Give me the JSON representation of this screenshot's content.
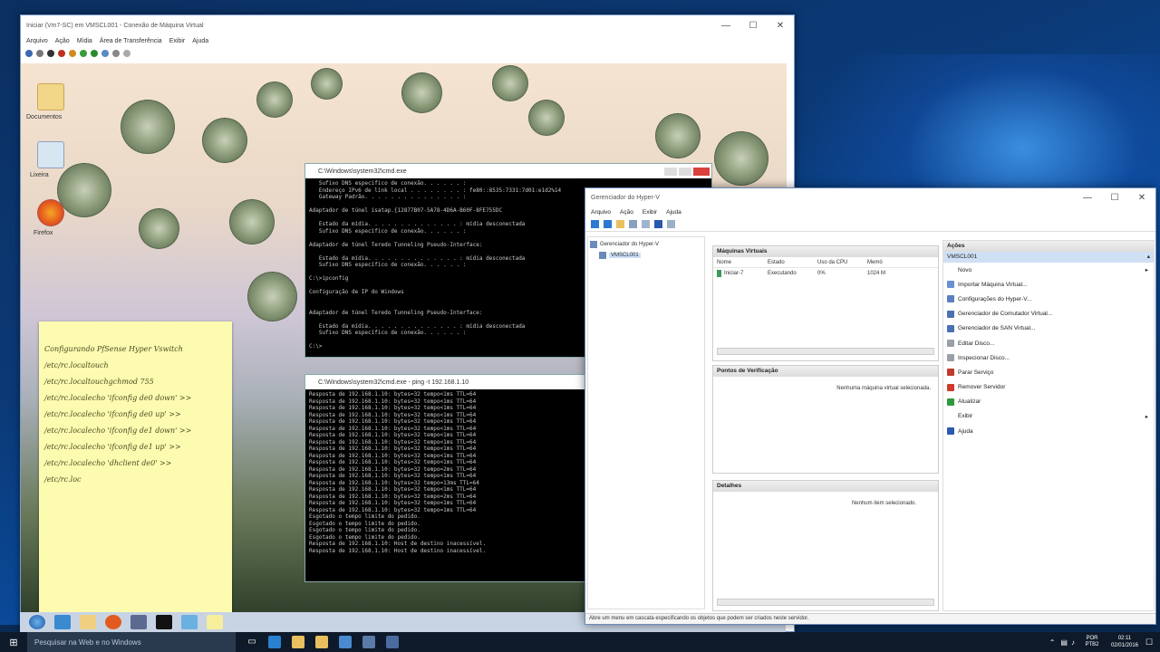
{
  "vm_window": {
    "title": "Iniciar (Vm7-SC) em VMSCL001 - Conexão de Máquina Virtual",
    "menu": [
      "Arquivo",
      "Ação",
      "Mídia",
      "Área de Transferência",
      "Exibir",
      "Ajuda"
    ],
    "controls": {
      "minimize": "—",
      "maximize": "☐",
      "close": "✕"
    }
  },
  "guest_desktop": {
    "icons": [
      {
        "label": "Documentos"
      },
      {
        "label": "Lixeira"
      },
      {
        "label": "Firefox"
      }
    ]
  },
  "sticky_note": {
    "lines": [
      "Configurando PfSense Hyper Vswitch",
      "/etc/rc.localtouch",
      "/etc/rc.localtouchgchmod 755",
      "/etc/rc.localecho 'ifconfig de0 down' >>",
      "/etc/rc.localecho 'ifconfig de0 up' >>",
      "/etc/rc.localecho 'ifconfig de1 down' >>",
      "/etc/rc.localecho 'ifconfig de1 up' >>",
      "/etc/rc.localecho 'dhclient de0' >>",
      "/etc/rc.loc"
    ]
  },
  "cmd1": {
    "title": "C:\\Windows\\system32\\cmd.exe",
    "body": "   Sufixo DNS especifico de conexão. . . . . . :\n   Endereço IPv6 de link local . . . . . . . . : fe80::8535:7331:7d01:e1d2%14\n   Gateway Padrão. . . . . . . . . . . . . . . :\n\nAdaptador de túnel isatap.{12877B07-5A78-4D6A-B60F-8FE755DC\n\n   Estado da mídia. . . . . . . . . . . . . . : mídia desconectada\n   Sufixo DNS específico de conexão. . . . . . :\n\nAdaptador de túnel Teredo Tunneling Pseudo-Interface:\n\n   Estado da mídia. . . . . . . . . . . . . . : mídia desconectada\n   Sufixo DNS específico de conexão. . . . . . :\n\nC:\\>ipconfig\n\nConfiguração de IP do Windows\n\n\nAdaptador de túnel Teredo Tunneling Pseudo-Interface:\n\n   Estado da mídia. . . . . . . . . . . . . . : mídia desconectada\n   Sufixo DNS específico de conexão. . . . . . :\n\nC:\\>"
  },
  "cmd2": {
    "title": "C:\\Windows\\system32\\cmd.exe - ping -t 192.168.1.10",
    "body": "Resposta de 192.168.1.10: bytes=32 tempo<1ms TTL=64\nResposta de 192.168.1.10: bytes=32 tempo<1ms TTL=64\nResposta de 192.168.1.10: bytes=32 tempo<1ms TTL=64\nResposta de 192.168.1.10: bytes=32 tempo<1ms TTL=64\nResposta de 192.168.1.10: bytes=32 tempo<1ms TTL=64\nResposta de 192.168.1.10: bytes=32 tempo<1ms TTL=64\nResposta de 192.168.1.10: bytes=32 tempo<1ms TTL=64\nResposta de 192.168.1.10: bytes=32 tempo<1ms TTL=64\nResposta de 192.168.1.10: bytes=32 tempo<1ms TTL=64\nResposta de 192.168.1.10: bytes=32 tempo<1ms TTL=64\nResposta de 192.168.1.10: bytes=32 tempo<1ms TTL=64\nResposta de 192.168.1.10: bytes=32 tempo=2ms TTL=64\nResposta de 192.168.1.10: bytes=32 tempo<1ms TTL=64\nResposta de 192.168.1.10: bytes=32 tempo=13ms TTL=64\nResposta de 192.168.1.10: bytes=32 tempo<1ms TTL=64\nResposta de 192.168.1.10: bytes=32 tempo=2ms TTL=64\nResposta de 192.168.1.10: bytes=32 tempo<1ms TTL=64\nResposta de 192.168.1.10: bytes=32 tempo=1ms TTL=64\nEsgotado o tempo limite do pedido.\nEsgotado o tempo limite do pedido.\nEsgotado o tempo limite do pedido.\nEsgotado o tempo limite do pedido.\nResposta de 192.168.1.10: Host de destino inacessível.\nResposta de 192.168.1.10: Host de destino inacessível."
  },
  "hyperv": {
    "title": "Gerenciador do Hyper-V",
    "menu": [
      "Arquivo",
      "Ação",
      "Exibir",
      "Ajuda"
    ],
    "tree_root": "Gerenciador do Hyper-V",
    "tree_server": "VMSCL001",
    "vm_pane": {
      "header": "Máquinas Virtuais",
      "columns": [
        "Nome",
        "Estado",
        "Uso da CPU",
        "Memó"
      ],
      "rows": [
        {
          "name": "Iniciar-7",
          "state": "Executando",
          "cpu": "0%",
          "mem": "1024 M"
        }
      ]
    },
    "checkpoints": {
      "header": "Pontos de Verificação",
      "empty": "Nenhuma máquina virtual selecionada."
    },
    "details": {
      "header": "Detalhes",
      "empty": "Nenhum item selecionado."
    },
    "actions": {
      "header": "Ações",
      "section": "VMSCL001",
      "items": [
        {
          "label": "Novo",
          "icon": "new-icon",
          "color": "#ffffff",
          "arrow": "▸"
        },
        {
          "label": "Importar Máquina Virtual...",
          "icon": "import-icon",
          "color": "#6b8fd0",
          "arrow": ""
        },
        {
          "label": "Configurações do Hyper-V...",
          "icon": "settings-icon",
          "color": "#5a80c0",
          "arrow": ""
        },
        {
          "label": "Gerenciador de Comutador Virtual...",
          "icon": "switch-icon",
          "color": "#4a70b0",
          "arrow": ""
        },
        {
          "label": "Gerenciador de SAN Virtual...",
          "icon": "san-icon",
          "color": "#4a70b0",
          "arrow": ""
        },
        {
          "label": "Editar Disco...",
          "icon": "edit-disk-icon",
          "color": "#9aa0a8",
          "arrow": ""
        },
        {
          "label": "Inspecionar Disco...",
          "icon": "inspect-disk-icon",
          "color": "#9aa0a8",
          "arrow": ""
        },
        {
          "label": "Parar Serviço",
          "icon": "stop-icon",
          "color": "#c0392b",
          "arrow": ""
        },
        {
          "label": "Remover Servidor",
          "icon": "remove-icon",
          "color": "#d03a2a",
          "arrow": ""
        },
        {
          "label": "Atualizar",
          "icon": "refresh-icon",
          "color": "#2e9a3e",
          "arrow": ""
        },
        {
          "label": "Exibir",
          "icon": "view-icon",
          "color": "#ffffff",
          "arrow": "▸"
        },
        {
          "label": "Ajuda",
          "icon": "help-icon",
          "color": "#2a5ab0",
          "arrow": ""
        }
      ]
    },
    "status": "Abre um menu em cascata especificando os objetos que podem ser criados neste servidor."
  },
  "host_taskbar": {
    "search_placeholder": "Pesquisar na Web e no Windows",
    "lang": "POR PTB2",
    "time": "02:11",
    "date": "02/01/2016"
  }
}
